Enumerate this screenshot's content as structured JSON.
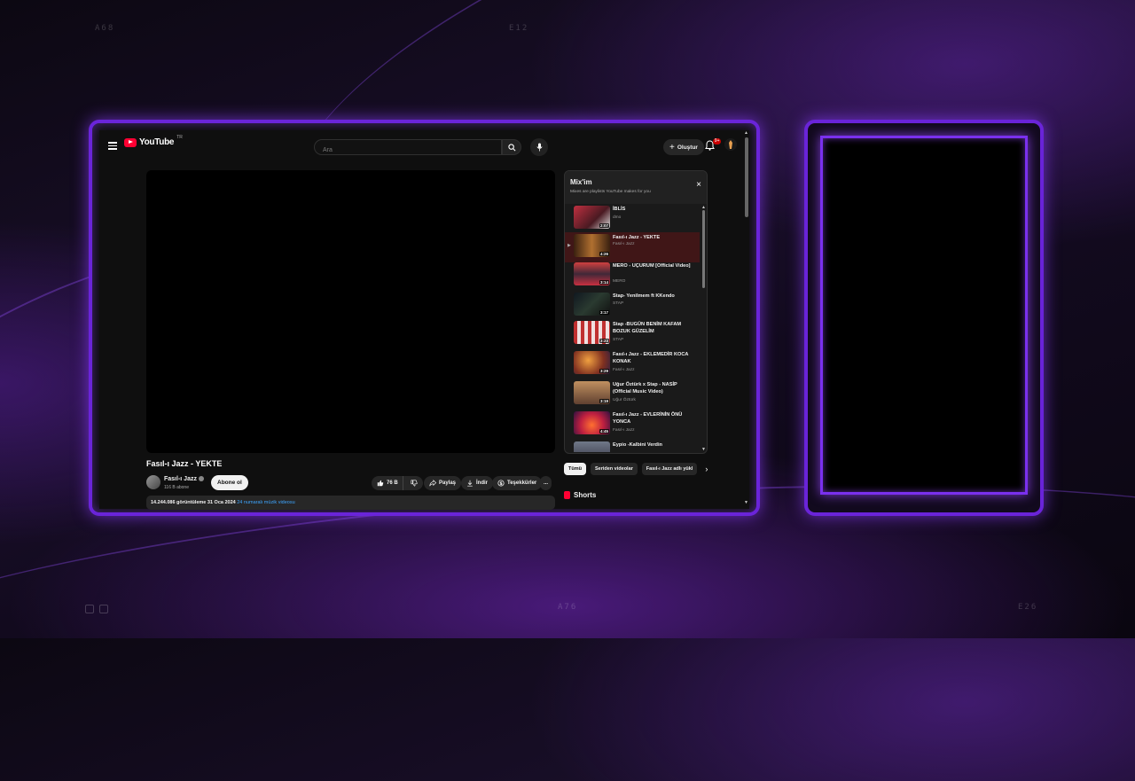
{
  "backdrop": {
    "labels": [
      "A68",
      "E12",
      "A76",
      "E26"
    ],
    "accent": "#6a24d9"
  },
  "youtube": {
    "logo_text": "YouTube",
    "logo_region": "TR",
    "search_placeholder": "Ara",
    "create_label": "Oluştur",
    "notification_count": "9+",
    "video": {
      "title": "Fasıl-ı Jazz - YEKTE",
      "channel": "Fasıl-ı Jazz",
      "subscribers": "116 B abone",
      "subscribe_label": "Abone ol",
      "likes": "76 B",
      "share_label": "Paylaş",
      "download_label": "İndir",
      "thanks_label": "Teşekkürler",
      "more_label": "...",
      "views_date": "14.244.086 görüntüleme  31 Oca 2024",
      "rank_tag": "24 numaralı müzik videosu"
    },
    "playlist": {
      "title": "Mix'im",
      "subtitle": "Mixes are playlists YouTube makes for you",
      "close_label": "×",
      "items": [
        {
          "title": "İBLİS",
          "channel": "dmo",
          "duration": "2:07"
        },
        {
          "title": "Fasıl-ı Jazz - YEKTE",
          "channel": "Fasıl-ı Jazz",
          "duration": "4:26"
        },
        {
          "title": "MERO - UÇURUM [Official Video]",
          "channel": "MERO",
          "duration": "3:14"
        },
        {
          "title": "Stap- Yenilmem ft KKendo",
          "channel": "STAP",
          "duration": "3:17"
        },
        {
          "title": "Stap -BUGÜN BENİM KAFAM BOZUK GÜZELİM",
          "channel": "STAP",
          "duration": "3:23"
        },
        {
          "title": "Fasıl-ı Jazz - EKLEMEDİR KOCA KONAK",
          "channel": "Fasıl-ı Jazz",
          "duration": "3:29"
        },
        {
          "title": "Uğur Öztürk x Stap - NASİP (Official Music Video)",
          "channel": "Uğur Öztürk",
          "duration": "3:19"
        },
        {
          "title": "Fasıl-ı Jazz - EVLERİNİN ÖNÜ YONCA",
          "channel": "Fasıl-ı Jazz",
          "duration": "4:45"
        },
        {
          "title": "Eypio -Kalbini Verdin",
          "channel": "",
          "duration": ""
        }
      ]
    },
    "chips": [
      "Tümü",
      "Seriden videolar",
      "Fasıl-ı Jazz adlı yükl"
    ],
    "shorts_label": "Shorts"
  }
}
